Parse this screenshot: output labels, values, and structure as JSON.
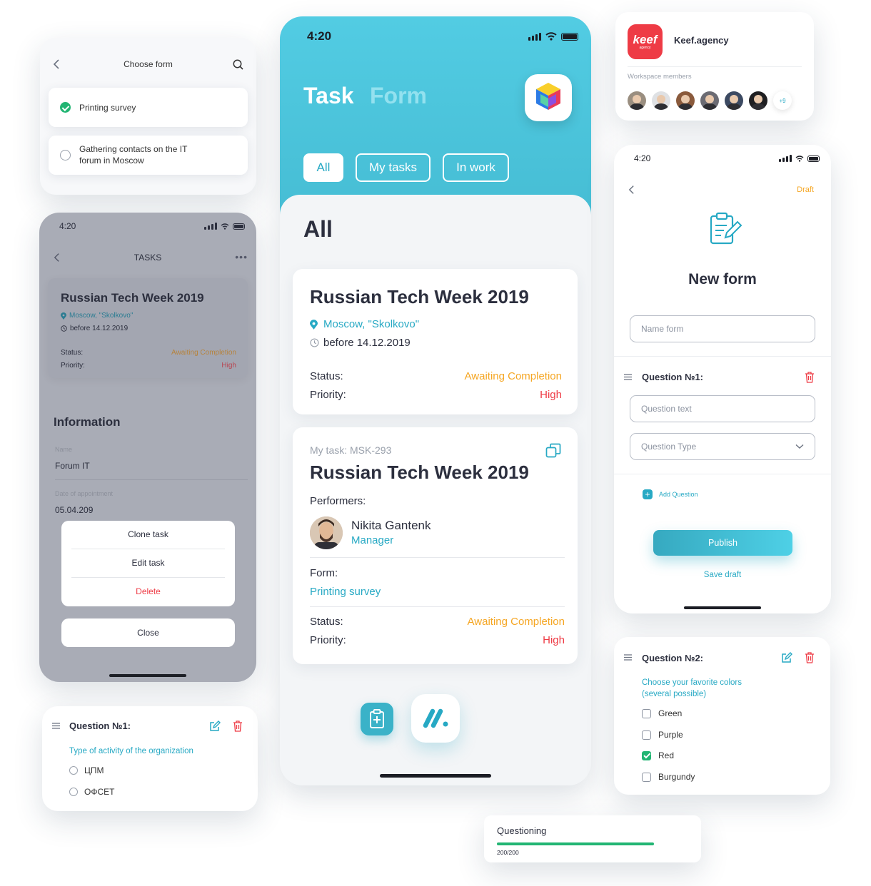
{
  "choose_form": {
    "title": "Choose form",
    "items": [
      {
        "label": "Printing survey",
        "selected": true
      },
      {
        "label": "Gathering contacts on the IT forum in Moscow",
        "selected": false
      }
    ]
  },
  "tasks_screen": {
    "time": "4:20",
    "header": "TASKS",
    "task": {
      "title": "Russian Tech Week 2019",
      "location": "Moscow, \"Skolkovo\"",
      "deadline": "before 14.12.2019",
      "status_label": "Status:",
      "status_value": "Awaiting Completion",
      "priority_label": "Priority:",
      "priority_value": "High"
    },
    "info_title": "Information",
    "fields": [
      {
        "label": "Name",
        "value": "Forum IT"
      },
      {
        "label": "Date of appointment",
        "value": "05.04.209"
      }
    ],
    "action_sheet": {
      "items": [
        "Clone task",
        "Edit task",
        "Delete"
      ],
      "close_label": "Close"
    }
  },
  "question1_card": {
    "title": "Question №1:",
    "question": "Type of activity of the organization",
    "options": [
      "ЦПМ",
      "ОФСЕТ"
    ]
  },
  "main_phone": {
    "time": "4:20",
    "title_task": "Task",
    "title_form": "Form",
    "tabs": [
      "All",
      "My tasks",
      "In work"
    ],
    "section_title": "All",
    "card1": {
      "title": "Russian Tech Week 2019",
      "location": "Moscow, \"Skolkovo\"",
      "deadline": "before 14.12.2019",
      "status_label": "Status:",
      "status_value": "Awaiting Completion",
      "priority_label": "Priority:",
      "priority_value": "High"
    },
    "card2": {
      "task_id": "My task: MSK-293",
      "title": "Russian Tech Week 2019",
      "performers_label": "Performers:",
      "performer_name": "Nikita Gantenk",
      "performer_role": "Manager",
      "form_label": "Form:",
      "form_value": "Printing survey",
      "status_label": "Status:",
      "status_value": "Awaiting Completion",
      "priority_label": "Priority:",
      "priority_value": "High"
    }
  },
  "agency": {
    "logo_text": "keef",
    "logo_sub": "agency",
    "name": "Keef.agency",
    "members_label": "Workspace members",
    "more_count": "+9"
  },
  "new_form": {
    "time": "4:20",
    "draft_label": "Draft",
    "title": "New form",
    "name_placeholder": "Name form",
    "question_title": "Question №1:",
    "question_text_placeholder": "Question text",
    "question_type_placeholder": "Question Type",
    "add_question": "Add Question",
    "publish": "Publish",
    "save_draft": "Save draft"
  },
  "question2_card": {
    "title": "Question №2:",
    "question": "Choose your favorite colors (several possible)",
    "options": [
      {
        "label": "Green",
        "checked": false
      },
      {
        "label": "Purple",
        "checked": false
      },
      {
        "label": "Red",
        "checked": true
      },
      {
        "label": "Burgundy",
        "checked": false
      }
    ]
  },
  "questioning": {
    "title": "Questioning",
    "count": "200/200",
    "progress": 1.0
  },
  "colors": {
    "teal": "#27a9c4",
    "orange": "#f5a623",
    "red": "#ee3b45",
    "green": "#22b573"
  }
}
